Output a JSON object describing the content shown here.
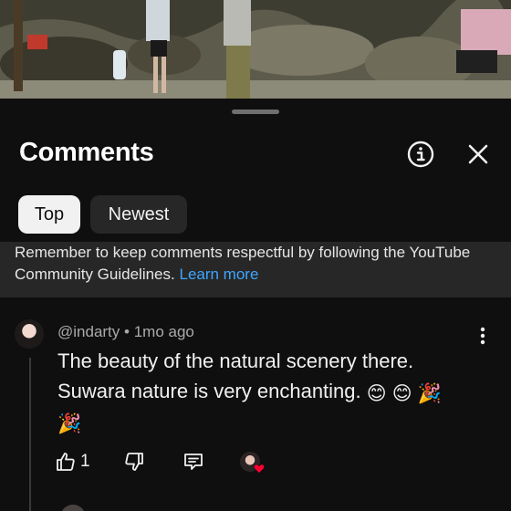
{
  "panel": {
    "title": "Comments",
    "info_icon": "info-icon",
    "close_icon": "close-icon"
  },
  "sort": {
    "options": [
      "Top",
      "Newest"
    ],
    "selected": "Top"
  },
  "notice": {
    "text": "Remember to keep comments respectful by following the YouTube Community Guidelines.",
    "link": "Learn more"
  },
  "comments": [
    {
      "author": "@indarty",
      "separator": "•",
      "time": "1mo ago",
      "line1": "The beauty of the natural scenery there.",
      "line2": "Suwara nature is very enchanting.",
      "emoji": [
        "😊",
        "😊",
        "🎉",
        "🎉"
      ],
      "likes": "1",
      "creator_heart": true
    }
  ],
  "colors": {
    "background": "#0f0f0f",
    "link": "#3ea6ff",
    "chip_selected": "#f1f1f1",
    "chip": "#272727",
    "heart": "#ff0033"
  }
}
